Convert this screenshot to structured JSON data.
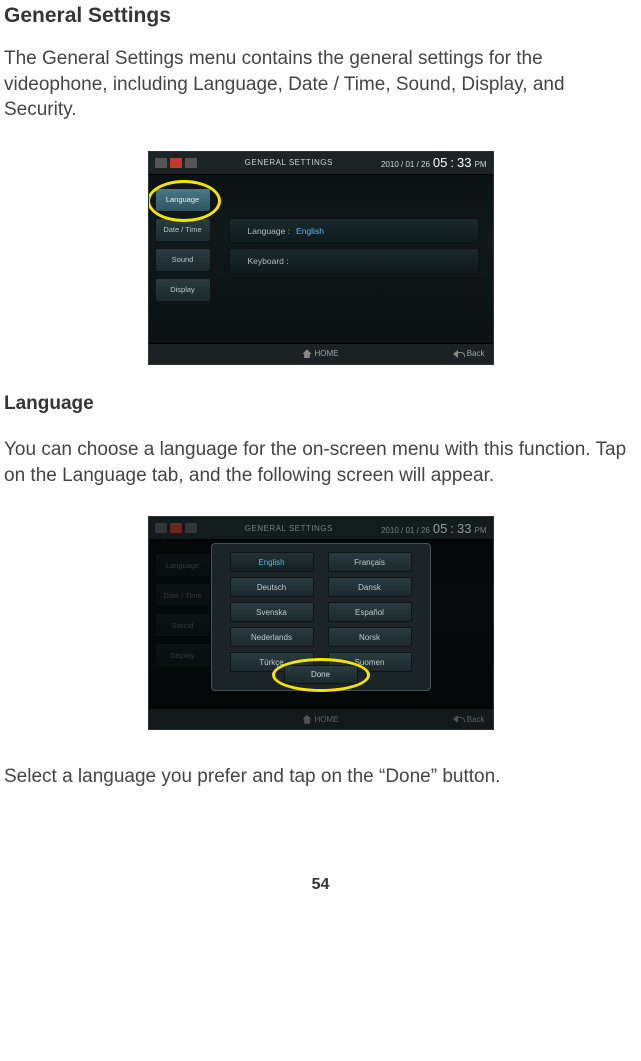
{
  "page": {
    "title": "General Settings",
    "intro": "The General Settings menu contains the general settings for the videophone, including Language, Date / Time, Sound, Display, and Security.",
    "section2_title": "Language",
    "section2_p": "You can choose a language for the on-screen menu with this function. Tap on the Language tab, and the following screen will appear.",
    "closing_p": "Select a language you prefer and tap on the “Done” button.",
    "page_number": "54"
  },
  "shared": {
    "statusbar_title": "GENERAL SETTINGS",
    "date": "2010 / 01 / 26",
    "time_h": "05",
    "time_sep": ":",
    "time_m": "33",
    "ampm": "PM",
    "home_label": "HOME",
    "back_label": "Back"
  },
  "fig1": {
    "tabs": [
      "Language",
      "Date / Time",
      "Sound",
      "Display"
    ],
    "row1_label": "Language :",
    "row1_value": "English",
    "row2_label": "Keyboard :"
  },
  "fig2": {
    "tabs": [
      "Language",
      "Date / Time",
      "Sound",
      "Display"
    ],
    "languages": [
      "English",
      "Français",
      "Deutsch",
      "Dansk",
      "Svenska",
      "Español",
      "Nederlands",
      "Norsk",
      "Türkçe",
      "Suomen"
    ],
    "done_label": "Done"
  }
}
